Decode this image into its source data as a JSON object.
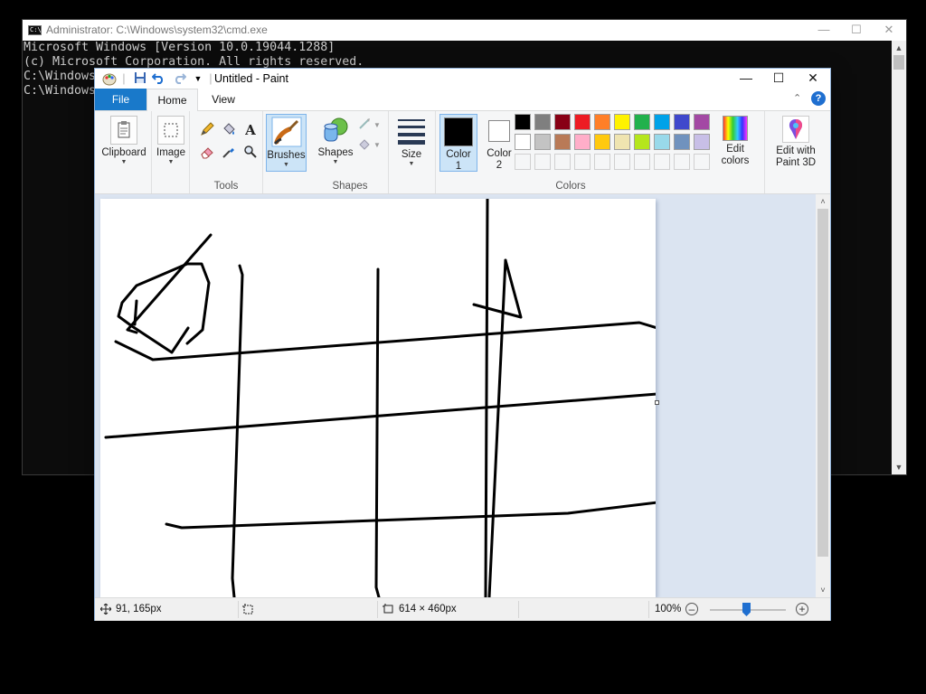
{
  "cmd": {
    "title": "Administrator: C:\\Windows\\system32\\cmd.exe",
    "lines": [
      "Microsoft Windows [Version 10.0.19044.1288]",
      "(c) Microsoft Corporation. All rights reserved.",
      "",
      "C:\\Windows",
      "",
      "C:\\Windows"
    ]
  },
  "paint": {
    "title": "Untitled - Paint",
    "tabs": {
      "file": "File",
      "home": "Home",
      "view": "View"
    },
    "ribbon": {
      "clipboard": "Clipboard",
      "image": "Image",
      "tools": "Tools",
      "brushes": "Brushes",
      "shapes_btn": "Shapes",
      "shapes_group": "Shapes",
      "size": "Size",
      "color1": [
        "Color",
        "1"
      ],
      "color2": [
        "Color",
        "2"
      ],
      "colors_group": "Colors",
      "edit_colors": [
        "Edit",
        "colors"
      ],
      "edit_paint3d": [
        "Edit with",
        "Paint 3D"
      ]
    },
    "palette": [
      "#000000",
      "#7f7f7f",
      "#880015",
      "#ed1c24",
      "#ff7f27",
      "#fff200",
      "#22b14c",
      "#00a2e8",
      "#3f48cc",
      "#a349a4",
      "#ffffff",
      "#c3c3c3",
      "#b97a57",
      "#ffaec9",
      "#ffc90e",
      "#efe4b0",
      "#b5e61d",
      "#99d9ea",
      "#7092be",
      "#c8bfe7"
    ],
    "color1": "#000000",
    "color2": "#ffffff",
    "status": {
      "cursor_pos": "91, 165px",
      "canvas_size": "614 × 460px",
      "zoom": "100%"
    }
  }
}
